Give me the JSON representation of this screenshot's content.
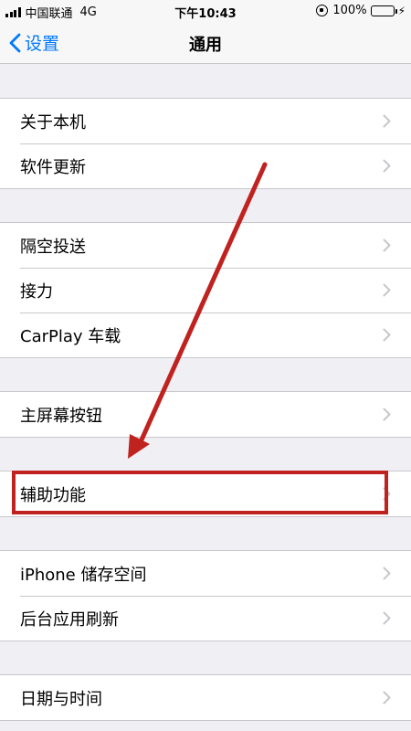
{
  "status_bar": {
    "carrier": "中国联通",
    "network": "4G",
    "time": "下午10:43",
    "battery_percent": "100%",
    "battery_level": 1.0,
    "icons": [
      "signal-icon",
      "rotation-lock-icon",
      "battery-icon",
      "charging-bolt-icon"
    ]
  },
  "nav": {
    "back_label": "设置",
    "title": "通用",
    "back_icon": "chevron-left-icon"
  },
  "groups": [
    {
      "items": [
        {
          "label": "关于本机"
        },
        {
          "label": "软件更新"
        }
      ]
    },
    {
      "items": [
        {
          "label": "隔空投送"
        },
        {
          "label": "接力"
        },
        {
          "label": "CarPlay 车载"
        }
      ]
    },
    {
      "items": [
        {
          "label": "主屏幕按钮"
        }
      ]
    },
    {
      "items": [
        {
          "label": "辅助功能"
        }
      ]
    },
    {
      "items": [
        {
          "label": "iPhone 储存空间"
        },
        {
          "label": "后台应用刷新"
        }
      ]
    },
    {
      "items": [
        {
          "label": "日期与时间"
        }
      ]
    }
  ],
  "colors": {
    "accent": "#007aff",
    "background": "#efeff4",
    "annotation": "#c0221f",
    "battery": "#4cd964"
  }
}
